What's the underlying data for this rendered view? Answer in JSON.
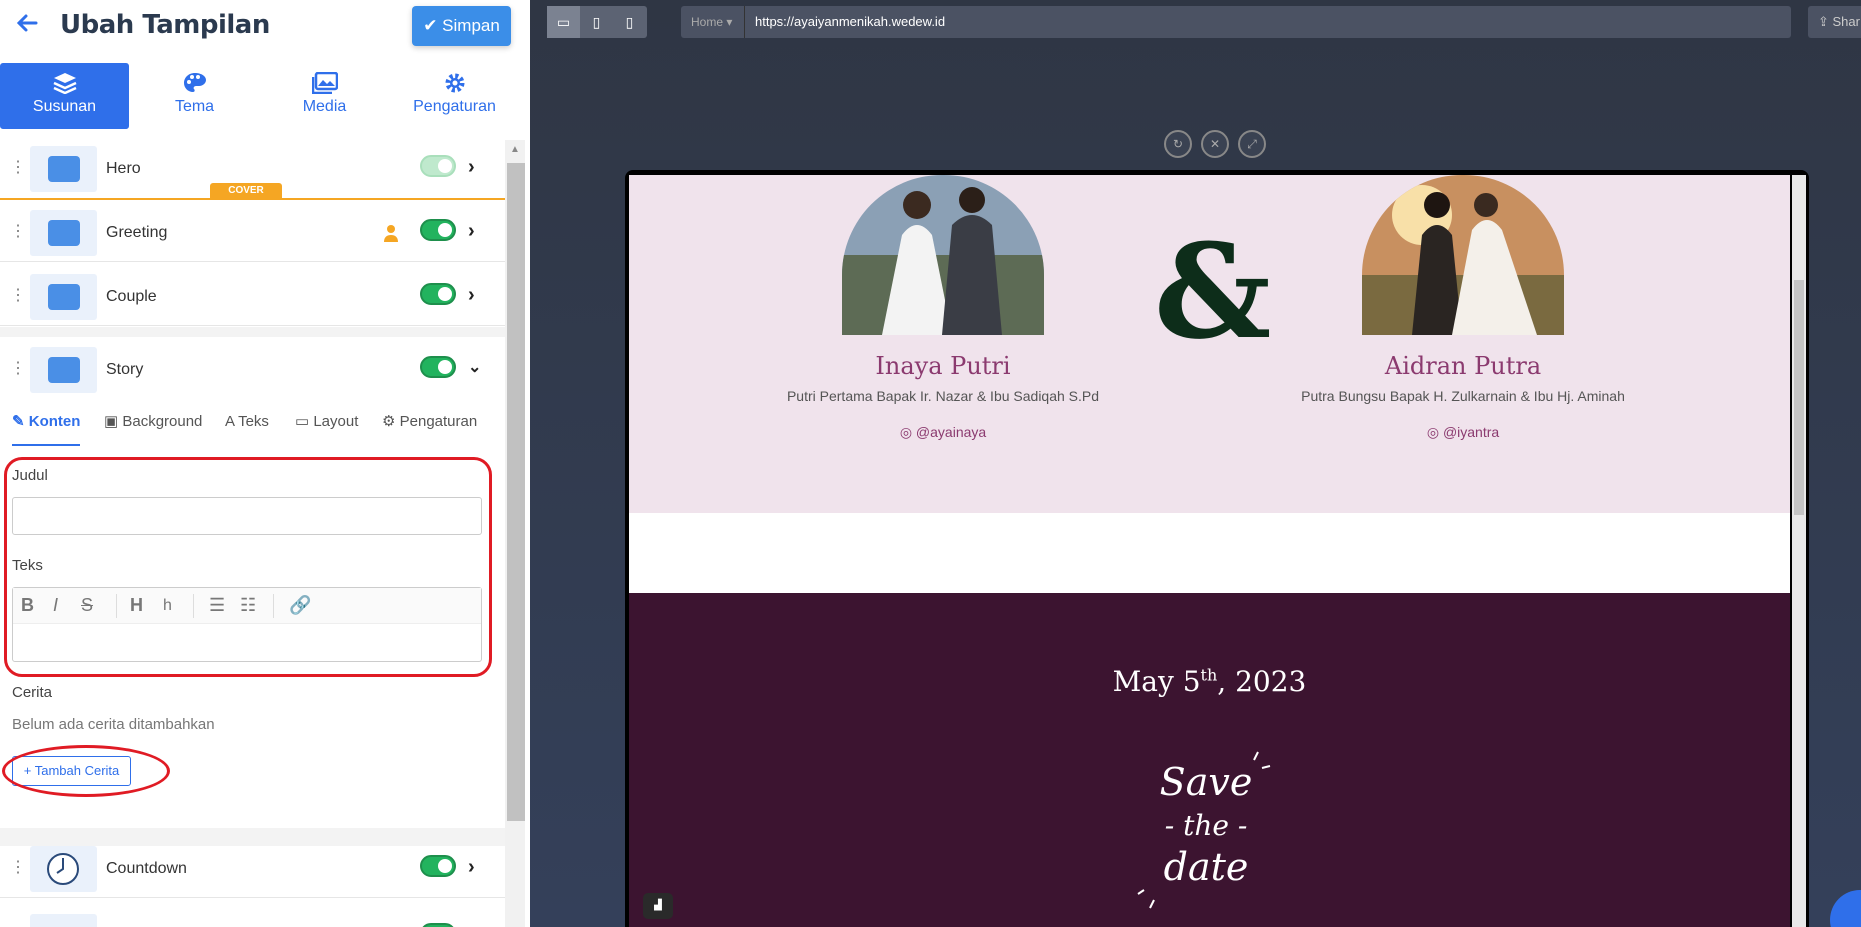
{
  "header": {
    "title": "Ubah Tampilan",
    "save_label": "Simpan"
  },
  "main_tabs": [
    {
      "label": "Susunan",
      "icon": "layers-icon"
    },
    {
      "label": "Tema",
      "icon": "palette-icon"
    },
    {
      "label": "Media",
      "icon": "images-icon"
    },
    {
      "label": "Pengaturan",
      "icon": "gear-icon"
    }
  ],
  "sections": [
    {
      "label": "Hero",
      "enabled": true
    },
    {
      "label": "Greeting",
      "enabled": true
    },
    {
      "label": "Couple",
      "enabled": true
    },
    {
      "label": "Story",
      "enabled": true
    },
    {
      "label": "Countdown",
      "enabled": true
    }
  ],
  "cover_badge": "COVER",
  "story_tabs": [
    "Konten",
    "Background",
    "Teks",
    "Layout",
    "Pengaturan"
  ],
  "form": {
    "judul_label": "Judul",
    "judul_value": "",
    "teks_label": "Teks",
    "cerita_label": "Cerita",
    "empty_text": "Belum ada cerita ditambahkan",
    "add_story": "Tambah Cerita"
  },
  "preview": {
    "home_select": "Home",
    "url": "https://ayaiyanmenikah.wedew.id",
    "share": "Shar",
    "bride": {
      "name": "Inaya Putri",
      "parents": "Putri Pertama Bapak Ir. Nazar & Ibu Sadiqah S.Pd",
      "instagram": "@ayainaya"
    },
    "groom": {
      "name": "Aidran Putra",
      "parents": "Putra Bungsu Bapak H. Zulkarnain & Ibu Hj. Aminah",
      "instagram": "@iyantra"
    },
    "ampersand": "&",
    "date_month": "May 5",
    "date_suffix": "th",
    "date_year": ", 2023",
    "save_the_date": [
      "Save",
      "- the -",
      "date"
    ]
  },
  "colors": {
    "accent": "#2f6fea",
    "toggle_on": "#22b35e",
    "highlight": "#e01b24",
    "couple_bg": "#f0e3ec",
    "plum_bg": "#3c1430"
  }
}
